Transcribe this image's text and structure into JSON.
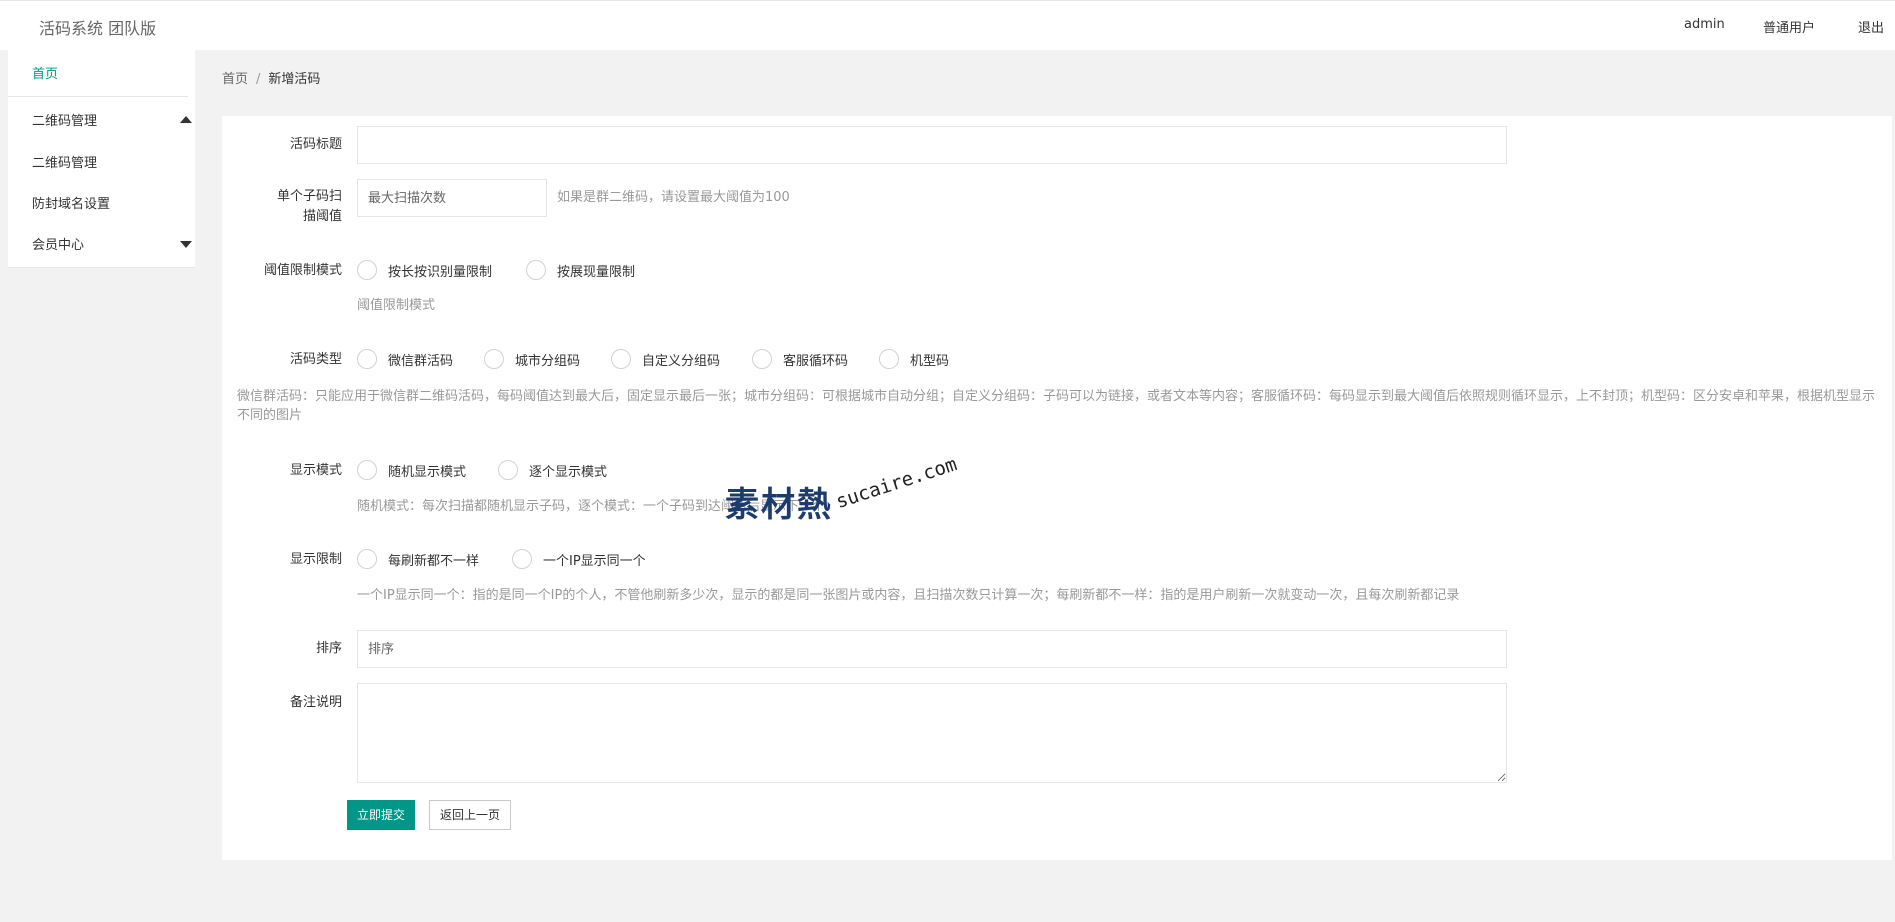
{
  "header": {
    "brand": "活码系统 团队版",
    "user_name": "admin",
    "user_role": "普通用户",
    "logout": "退出"
  },
  "sidebar": {
    "home": "首页",
    "qr_management": "二维码管理",
    "qr_management_sub": "二维码管理",
    "domain_settings": "防封域名设置",
    "member_center": "会员中心"
  },
  "breadcrumb": {
    "home": "首页",
    "separator": "/",
    "current": "新增活码"
  },
  "form": {
    "title_label": "活码标题",
    "title_value": "",
    "threshold_label": "单个子码扫描阈值",
    "threshold_placeholder": "最大扫描次数",
    "threshold_hint": "如果是群二维码，请设置最大阈值为100",
    "limit_mode_label": "阈值限制模式",
    "limit_mode_options": [
      "按长按识别量限制",
      "按展现量限制"
    ],
    "limit_mode_hint": "阈值限制模式",
    "type_label": "活码类型",
    "type_options": [
      "微信群活码",
      "城市分组码",
      "自定义分组码",
      "客服循环码",
      "机型码"
    ],
    "type_hint": "微信群活码：只能应用于微信群二维码活码，每码阈值达到最大后，固定显示最后一张；城市分组码：可根据城市自动分组；自定义分组码：子码可以为链接，或者文本等内容；客服循环码：每码显示到最大阈值后依照规则循环显示，上不封顶；机型码：区分安卓和苹果，根据机型显示不同的图片",
    "display_mode_label": "显示模式",
    "display_mode_options": [
      "随机显示模式",
      "逐个显示模式"
    ],
    "display_mode_hint": "随机模式：每次扫描都随机显示子码，逐个模式：一个子码到达阈值后显示下一个",
    "display_limit_label": "显示限制",
    "display_limit_options": [
      "每刷新都不一样",
      "一个IP显示同一个"
    ],
    "display_limit_hint": "一个IP显示同一个：指的是同一个IP的个人，不管他刷新多少次，显示的都是同一张图片或内容，且扫描次数只计算一次；每刷新都不一样：指的是用户刷新一次就变动一次，且每次刷新都记录",
    "sort_label": "排序",
    "sort_placeholder": "排序",
    "remark_label": "备注说明",
    "remark_value": "",
    "submit_label": "立即提交",
    "back_label": "返回上一页"
  },
  "watermark": {
    "cn": "素材熱",
    "en": "sucaire.com"
  }
}
